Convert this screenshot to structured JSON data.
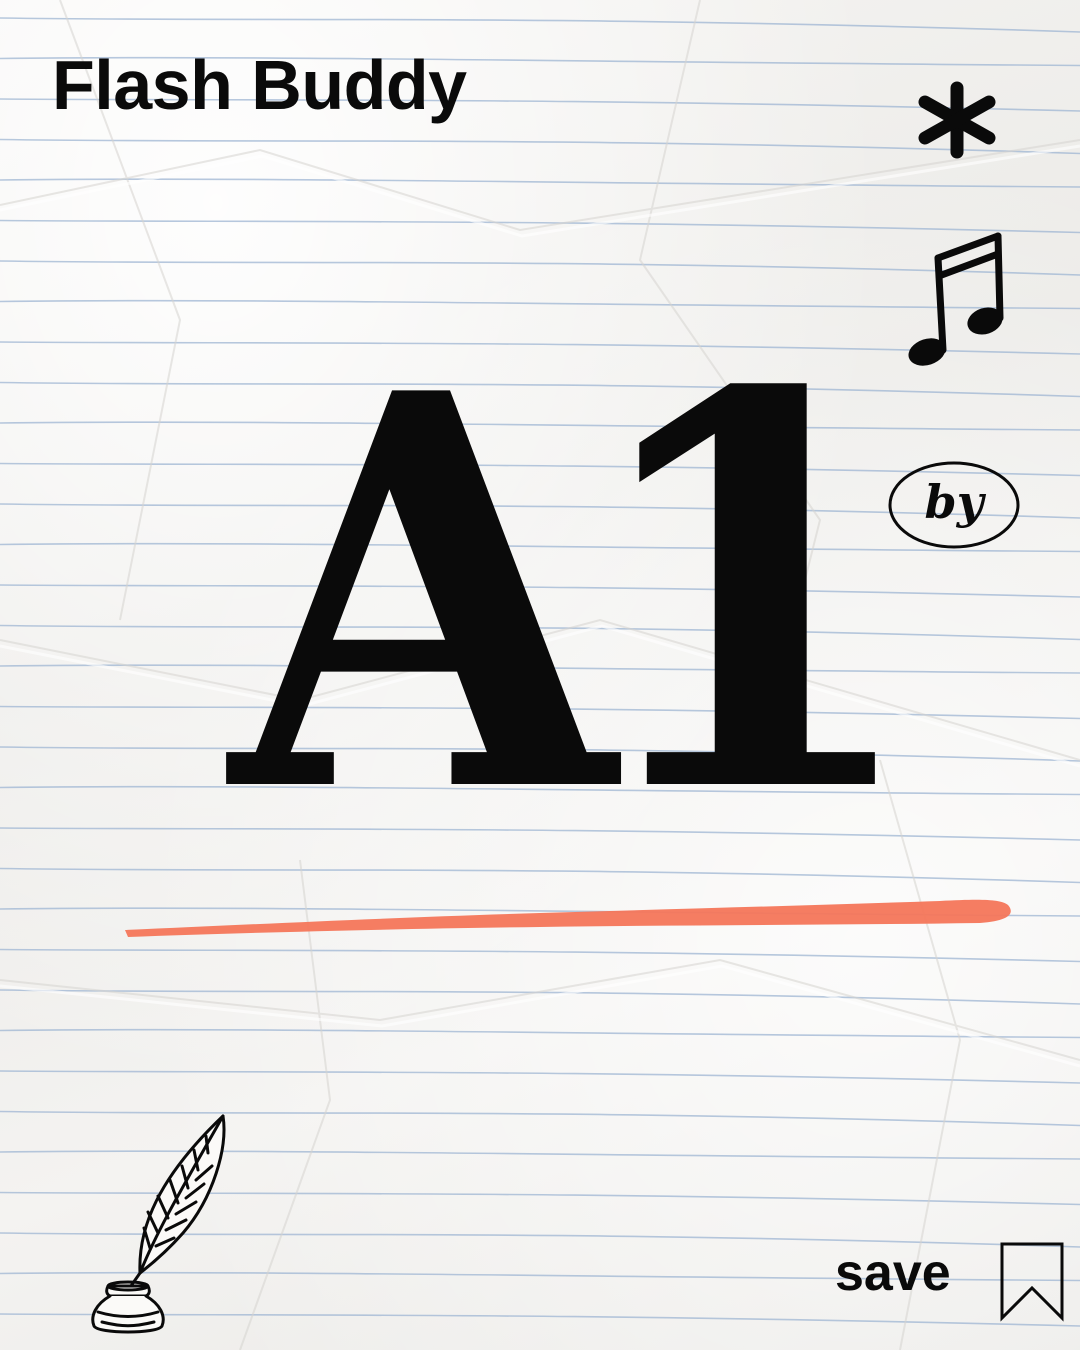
{
  "brand": {
    "name": "Flash Buddy"
  },
  "card": {
    "headline": "A1"
  },
  "badge": {
    "label": "by"
  },
  "actions": {
    "save_label": "save"
  },
  "icons": {
    "asterisk": "asterisk-icon",
    "music": "music-note-icon",
    "by_badge": "by-badge-icon",
    "quill": "quill-inkwell-icon",
    "bookmark": "bookmark-icon"
  },
  "colors": {
    "ink": "#0a0a0a",
    "accent": "#f4765a",
    "ruled_line": "#9fb6d3",
    "paper": "#f3f2f0"
  }
}
